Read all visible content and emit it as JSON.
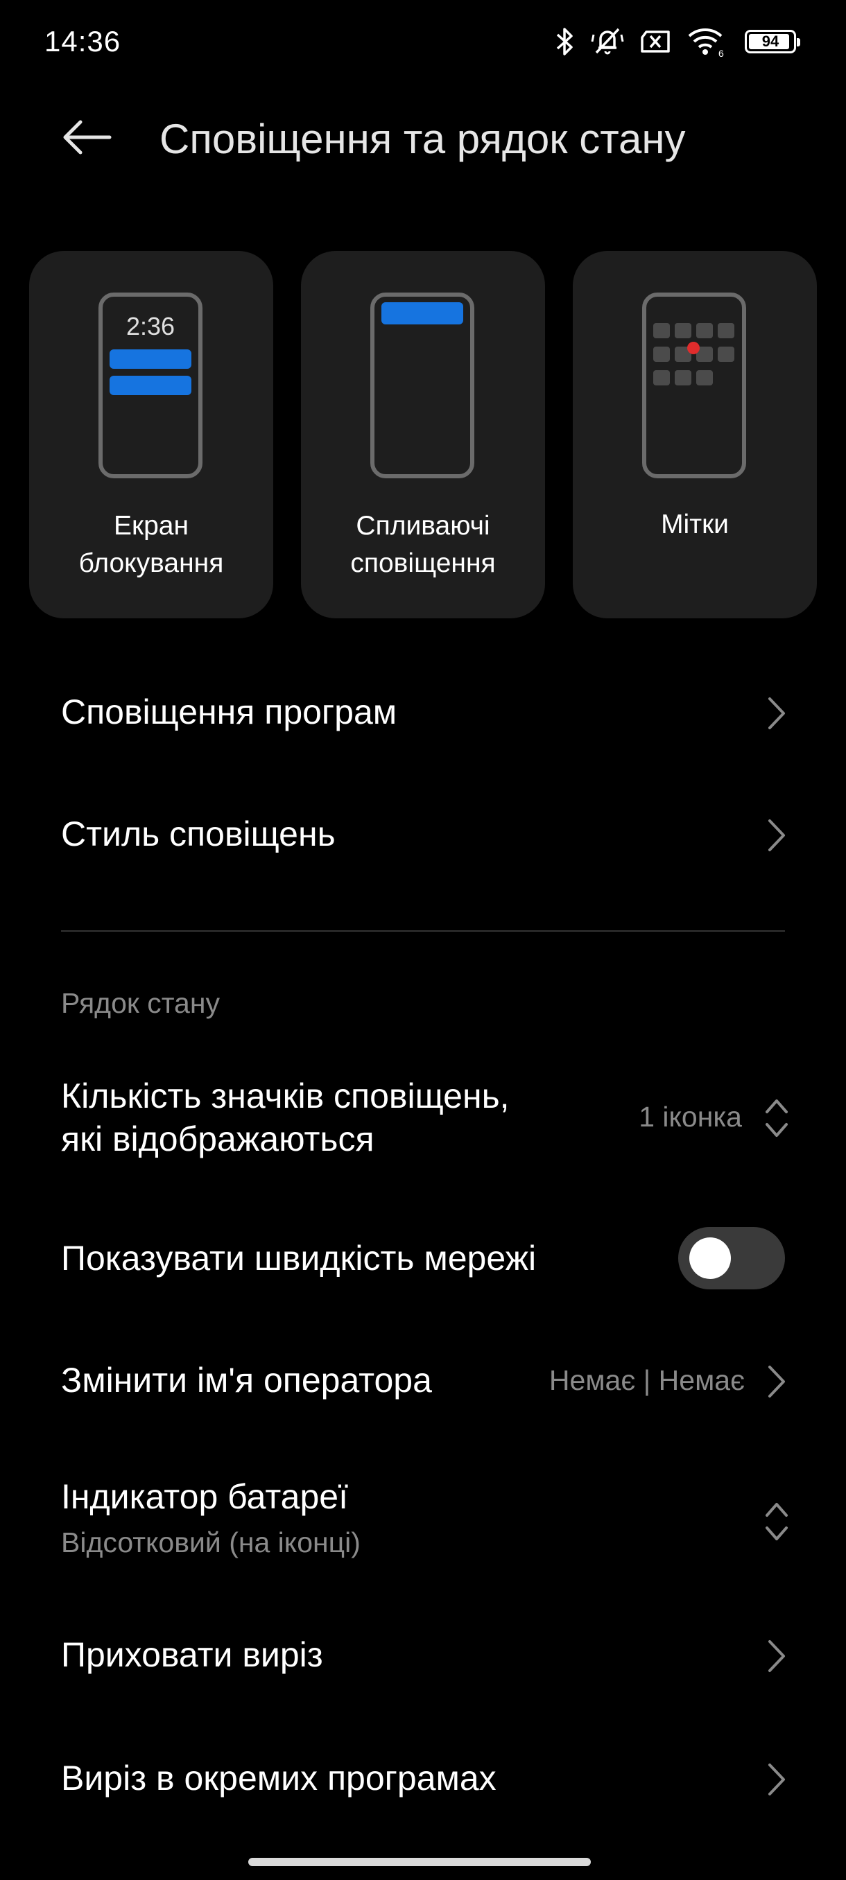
{
  "status_bar": {
    "time": "14:36",
    "battery_level": "94",
    "icons": [
      "bluetooth-icon",
      "mute-vibrate-icon",
      "no-sim-icon",
      "wifi-icon",
      "battery-icon"
    ]
  },
  "header": {
    "title": "Сповіщення та рядок стану",
    "back_icon": "arrow-left-icon"
  },
  "cards": [
    {
      "label": "Екран\nблокування",
      "preview_time": "2:36"
    },
    {
      "label": "Спливаючі\nсповіщення"
    },
    {
      "label": "Мітки"
    }
  ],
  "menu": {
    "app_notifications": "Сповіщення програм",
    "notification_style": "Стиль сповіщень"
  },
  "status_bar_section": {
    "title": "Рядок стану",
    "icon_count_label": "Кількість значків сповіщень,\nякі відображаються",
    "icon_count_value": "1 іконка",
    "show_network_speed_label": "Показувати швидкість мережі",
    "show_network_speed_enabled": false,
    "carrier_name_label": "Змінити ім'я оператора",
    "carrier_name_value": "Немає | Немає",
    "battery_indicator_label": "Індикатор батареї",
    "battery_indicator_value": "Відсотковий (на іконці)",
    "hide_notch_label": "Приховати виріз",
    "notch_apps_label": "Виріз в окремих програмах"
  },
  "colors": {
    "background": "#000000",
    "card": "#1e1e1e",
    "accent_blue": "#1674e0",
    "secondary_text": "#8a8a8a"
  }
}
